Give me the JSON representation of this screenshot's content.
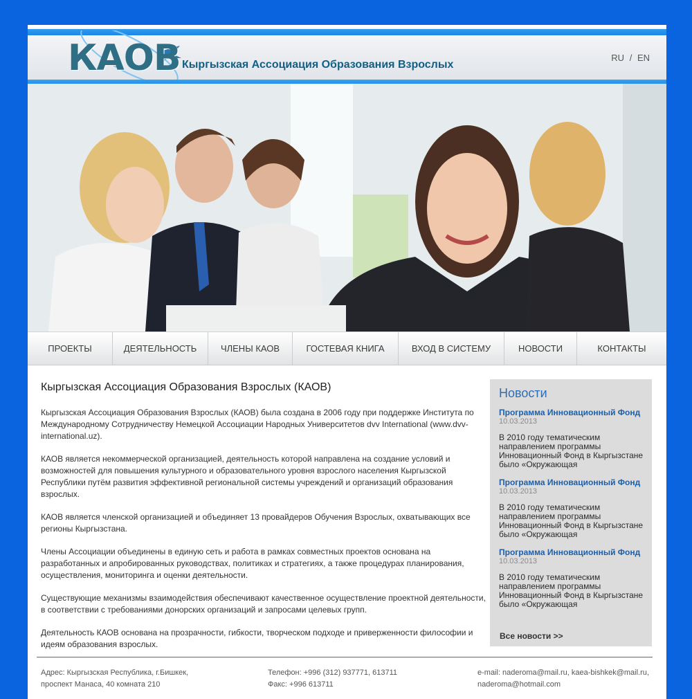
{
  "header": {
    "logo_text": "КАОВ",
    "title": "Кыргызская Ассоциация Образования Взрослых",
    "lang_ru": "RU",
    "lang_sep": "/",
    "lang_en": "EN"
  },
  "hero": {
    "icon": "photo-people"
  },
  "nav": {
    "items": [
      "ПРОЕКТЫ",
      "ДЕЯТЕЛЬНОСТЬ",
      "ЧЛЕНЫ КАОВ",
      "ГОСТЕВАЯ КНИГА",
      "ВХОД В СИСТЕМУ",
      "НОВОСТИ",
      "КОНТАКТЫ"
    ]
  },
  "content": {
    "heading": "Кыргызская Ассоциация Образования Взрослых (КАОВ)",
    "paragraphs": [
      "Кыргызская Ассоциация Образования Взрослых (КАОВ) была создана в 2006 году при поддержке Института по Международному Сотрудничеству Немецкой Ассоциации Народных Университетов dvv International (www.dvv-international.uz).",
      "КАОВ является некоммерческой организацией, деятельность которой направлена на создание условий и возможностей для повышения культурного и образовательного уровня взрослого населения Кыргызской Республики путём развития эффективной региональной системы учреждений и организаций образования взрослых.",
      "КАОВ является членской организацией и объединяет 13 провайдеров Обучения Взрослых, охватывающих все регионы Кыргызстана.",
      "Члены Ассоциации объединены в единую сеть и работа в рамках совместных проектов основана на разработанных и апробированных руководствах, политиках и стратегиях, а также процедурах планирования, осуществления, мониторинга и оценки деятельности.",
      "Существующие механизмы взаимодействия обеспечивают качественное осуществление проектной деятельности, в соответствии с требованиями донорских организаций и запросами целевых групп.",
      "Деятельность КАОВ основана на прозрачности, гибкости, творческом подходе и приверженности философии и идеям образования взрослых."
    ]
  },
  "sidebar": {
    "title": "Новости",
    "news": [
      {
        "title": "Программа Инновационный Фонд",
        "date": "10.03.2013",
        "text": "В 2010 году тематическим направлением программы Инновационный Фонд в Кыргызстане было «Окружающая"
      },
      {
        "title": "Программа Инновационный Фонд",
        "date": "10.03.2013",
        "text": "В 2010 году тематическим направлением программы Инновационный Фонд в Кыргызстане было «Окружающая"
      },
      {
        "title": "Программа Инновационный Фонд",
        "date": "10.03.2013",
        "text": "В 2010 году тематическим направлением программы Инновационный Фонд в Кыргызстане было «Окружающая"
      }
    ],
    "all_news": "Все новости  >>"
  },
  "footer": {
    "address_line1": "Адрес: Кыргызская Республика, г.Бишкек,",
    "address_line2": "проспект Манаса, 40 комната 210",
    "phone": "Телефон: +996 (312) 937771, 613711",
    "fax": "Факс: +996 613711",
    "email_line1": "e-mail: naderoma@mail.ru, kaea-bishkek@mail.ru,",
    "email_line2": "naderoma@hotmail.com"
  },
  "colors": {
    "background": "#0a64e0",
    "accent": "#1d86e6",
    "news_title": "#1d5fa8",
    "sidebar_bg": "#dcdcdc"
  }
}
